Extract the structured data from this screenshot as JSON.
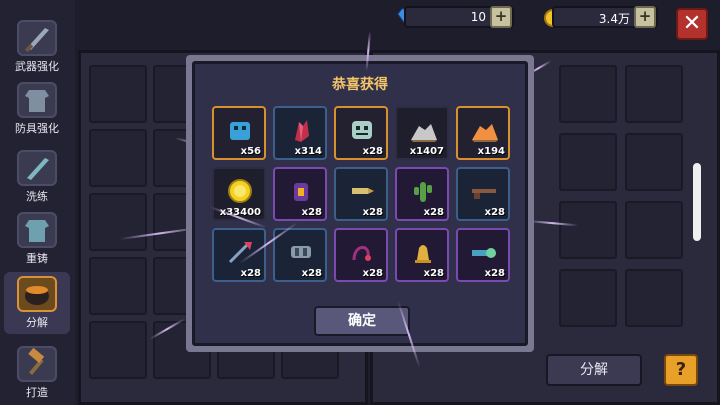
{
  "sidebar": {
    "items": [
      {
        "label": "武器强化",
        "icon": "sword-icon"
      },
      {
        "label": "防具强化",
        "icon": "armor-icon"
      },
      {
        "label": "洗练",
        "icon": "wash-icon"
      },
      {
        "label": "重铸",
        "icon": "recast-icon"
      },
      {
        "label": "分解",
        "icon": "cauldron-icon"
      },
      {
        "label": "打造",
        "icon": "hammer-icon"
      }
    ]
  },
  "topbar": {
    "gems": "10",
    "coins": "3.4万",
    "close": "✕"
  },
  "modal": {
    "title": "恭喜获得",
    "confirm": "确定",
    "items": [
      {
        "qty": "x56",
        "icon": "blue-crystal-icon",
        "frame": "gold"
      },
      {
        "qty": "x314",
        "icon": "red-crystal-icon",
        "frame": "blue"
      },
      {
        "qty": "x28",
        "icon": "skull-icon",
        "frame": "gold"
      },
      {
        "qty": "x1407",
        "icon": "ore-pile-icon",
        "frame": "plain"
      },
      {
        "qty": "x194",
        "icon": "orange-ore-icon",
        "frame": "gold"
      },
      {
        "qty": "x33400",
        "icon": "gold-coin-icon",
        "frame": "plain"
      },
      {
        "qty": "x28",
        "icon": "lantern-icon",
        "frame": "purple"
      },
      {
        "qty": "x28",
        "icon": "bullet-icon",
        "frame": "blue"
      },
      {
        "qty": "x28",
        "icon": "cactus-icon",
        "frame": "purple"
      },
      {
        "qty": "x28",
        "icon": "rifle-icon",
        "frame": "blue"
      },
      {
        "qty": "x28",
        "icon": "spear-icon",
        "frame": "blue"
      },
      {
        "qty": "x28",
        "icon": "canister-icon",
        "frame": "blue"
      },
      {
        "qty": "x28",
        "icon": "whip-icon",
        "frame": "purple"
      },
      {
        "qty": "x28",
        "icon": "bell-icon",
        "frame": "purple"
      },
      {
        "qty": "x28",
        "icon": "scope-icon",
        "frame": "purple"
      }
    ]
  },
  "bottom": {
    "decompose": "分解",
    "help": "?"
  }
}
